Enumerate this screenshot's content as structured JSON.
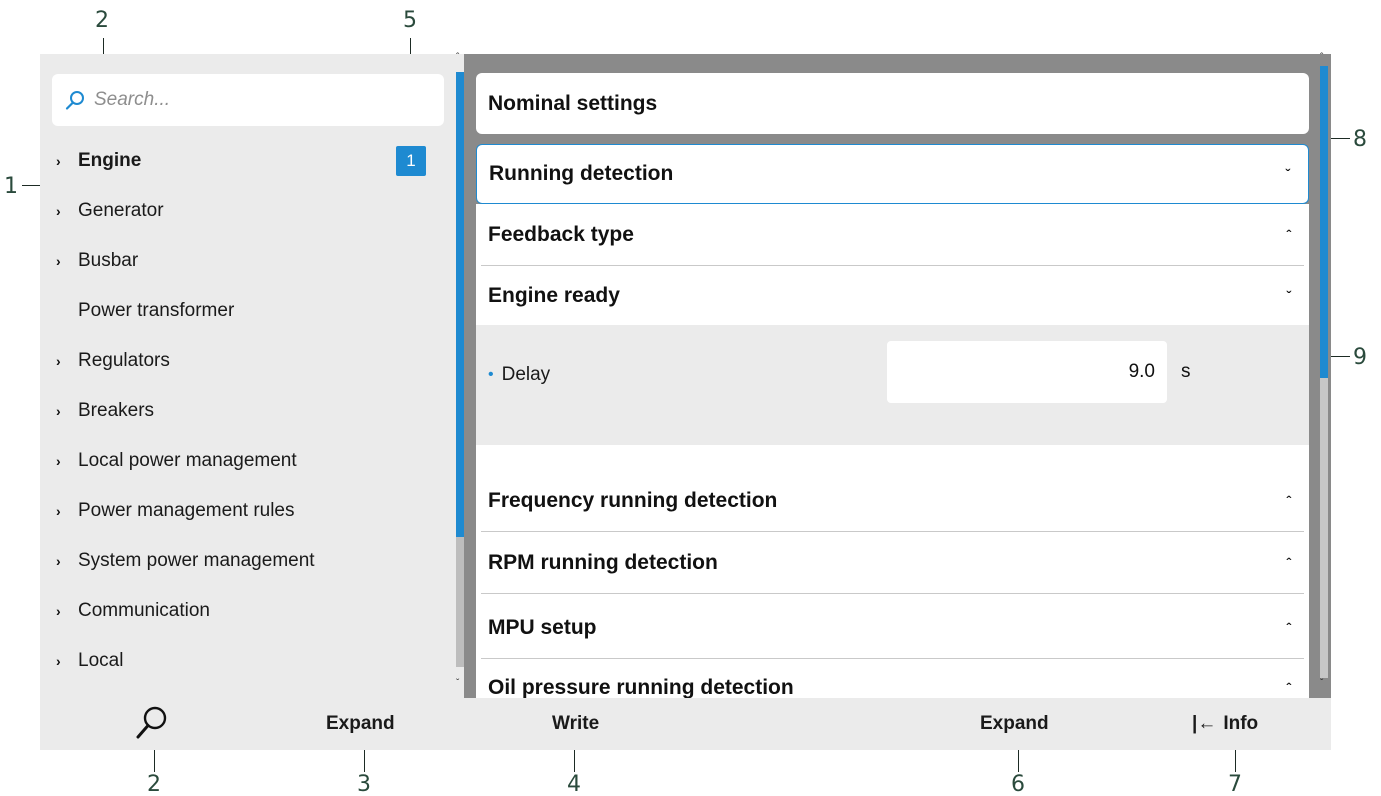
{
  "callouts": [
    "1",
    "2",
    "3",
    "4",
    "5",
    "6",
    "7",
    "8",
    "9"
  ],
  "search": {
    "placeholder": "Search..."
  },
  "sidebar": {
    "badge": "1",
    "items": [
      {
        "label": "Engine",
        "has_chevron": true,
        "active": true
      },
      {
        "label": "Generator",
        "has_chevron": true
      },
      {
        "label": "Busbar",
        "has_chevron": true
      },
      {
        "label": "Power transformer",
        "has_chevron": false
      },
      {
        "label": "Regulators",
        "has_chevron": true
      },
      {
        "label": "Breakers",
        "has_chevron": true
      },
      {
        "label": "Local power management",
        "has_chevron": true
      },
      {
        "label": "Power management rules",
        "has_chevron": true
      },
      {
        "label": "System power management",
        "has_chevron": true
      },
      {
        "label": "Communication",
        "has_chevron": true
      },
      {
        "label": "Local",
        "has_chevron": true
      }
    ]
  },
  "main": {
    "sections": [
      {
        "label": "Nominal settings"
      },
      {
        "label": "Running detection",
        "expanded": true,
        "selected": true
      },
      {
        "label": "Feedback type",
        "expanded": false
      },
      {
        "label": "Engine ready",
        "expanded": true
      },
      {
        "label": "Frequency running detection",
        "expanded": false
      },
      {
        "label": "RPM running detection",
        "expanded": false
      },
      {
        "label": "MPU setup",
        "expanded": false
      },
      {
        "label": "Oil pressure running detection",
        "expanded": false
      }
    ],
    "delay": {
      "label": "Delay",
      "value": "9.0",
      "unit": "s"
    }
  },
  "toolbar": {
    "expand_left": "Expand",
    "write": "Write",
    "expand_right": "Expand",
    "info": "Info"
  },
  "glyphs": {
    "chevron_right": "›",
    "caret_down": "ˇ",
    "caret_up": "ˆ",
    "dot": "•",
    "info_arrow": "|←"
  },
  "colors": {
    "accent": "#1e8ad1",
    "panel_bg": "#ebebeb",
    "right_bg": "#8a8a8a"
  }
}
